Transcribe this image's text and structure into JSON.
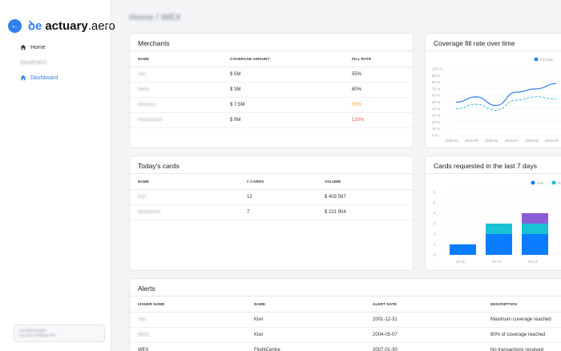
{
  "sidebar": {
    "logo_mark": "ꝺe",
    "logo_bold": "actuary",
    "logo_light": ".aero",
    "items": [
      {
        "label": "Home"
      },
      {
        "label": "Sandman1"
      },
      {
        "label": "Dashboard"
      }
    ],
    "footer_line1": "user@example",
    "footer_line2": "account settings info"
  },
  "page": {
    "title": "Home / WEX"
  },
  "merchants": {
    "title": "Merchants",
    "columns": [
      "NAME",
      "COVERAGE AMOUNT",
      "FILL RATE"
    ],
    "rows": [
      {
        "name": "Sxx",
        "amount": "$ 5M",
        "rate": "55%"
      },
      {
        "name": "Mxxx",
        "amount": "$ 3M",
        "rate": "80%"
      },
      {
        "name": "Bxxxxxx",
        "amount": "$ 7.5M",
        "rate": "95%"
      },
      {
        "name": "Kxxxxxxxxx",
        "amount": "$ 9M",
        "rate": "120%"
      }
    ]
  },
  "todays_cards": {
    "title": "Today's cards",
    "columns": [
      "NAME",
      "# CARDS",
      "VOLUME"
    ],
    "rows": [
      {
        "name": "Kxx",
        "cards": "12",
        "volume": "$ 403 567"
      },
      {
        "name": "Bxxxxxxxx",
        "cards": "7",
        "volume": "$ 221 904"
      }
    ]
  },
  "alerts": {
    "title": "Alerts",
    "columns": [
      "ISSUER NAME",
      "NAME",
      "ALERT DATE",
      "DESCRIPTION"
    ],
    "rows": [
      {
        "issuer": "Sxx",
        "name": "Kiwi",
        "date": "2001-12-31",
        "description": "Maximum coverage reached"
      },
      {
        "issuer": "Mxxx",
        "name": "Kiwi",
        "date": "2004-05-07",
        "description": "80% of coverage reached"
      },
      {
        "issuer": "WEX",
        "name": "FlightCentre",
        "date": "2007-01-30",
        "description": "No transactions received"
      }
    ]
  },
  "coverage_chart": {
    "title": "Coverage fill rate over time",
    "legend_label": "Fill Rate",
    "colors": {
      "series": "#2f80ed",
      "dashed": "#33b5e5"
    }
  },
  "requested_chart": {
    "title": "Cards requested in the last 7 days",
    "legend": [
      "Kiwi",
      "To"
    ],
    "colors": {
      "kiwi": "#0a7cff",
      "to": "#19c3d6",
      "third": "#8a5cd6"
    }
  },
  "chart_data": [
    {
      "type": "line",
      "x": [
        "2025-04",
        "2025-05",
        "2025-06",
        "2025-07",
        "2025-08",
        "2025-09"
      ],
      "ylim": [
        0,
        100
      ],
      "yticks": [
        "100 %",
        "90 %",
        "80 %",
        "70 %",
        "60 %",
        "50 %",
        "40 %",
        "30 %",
        "20 %",
        "10 %",
        "0 %"
      ],
      "series": [
        {
          "name": "Fill Rate",
          "values": [
            50,
            58,
            45,
            65,
            70,
            78
          ]
        },
        {
          "values": [
            40,
            47,
            38,
            53,
            58,
            55
          ]
        }
      ]
    },
    {
      "type": "bar",
      "categories": [
        "02-11",
        "02-12",
        "02-13"
      ],
      "ylim": [
        0,
        6
      ],
      "yticks": [
        "6",
        "5",
        "4",
        "3",
        "2",
        "1",
        "0"
      ],
      "series": [
        {
          "name": "Kiwi",
          "values": [
            1,
            2,
            2
          ]
        },
        {
          "name": "To",
          "values": [
            0,
            1,
            1
          ]
        },
        {
          "values": [
            0,
            0,
            1
          ]
        }
      ]
    }
  ]
}
